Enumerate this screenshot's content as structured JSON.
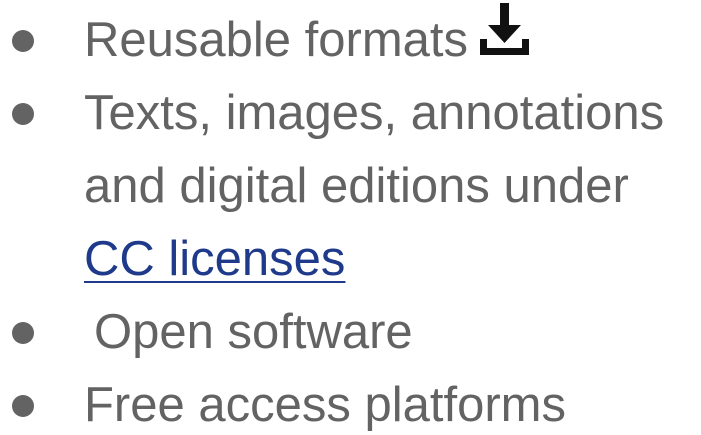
{
  "bullets": [
    {
      "lines": [
        "Reusable formats"
      ],
      "icon": "download-icon"
    },
    {
      "lines": [
        "Texts, images, annotations",
        "and digital editions under"
      ],
      "link": "CC licenses"
    },
    {
      "lines": [
        "Open software"
      ]
    },
    {
      "lines": [
        "Free access platforms"
      ]
    }
  ],
  "colors": {
    "text": "#636363",
    "link": "#1f3a8a",
    "icon": "#111111"
  }
}
